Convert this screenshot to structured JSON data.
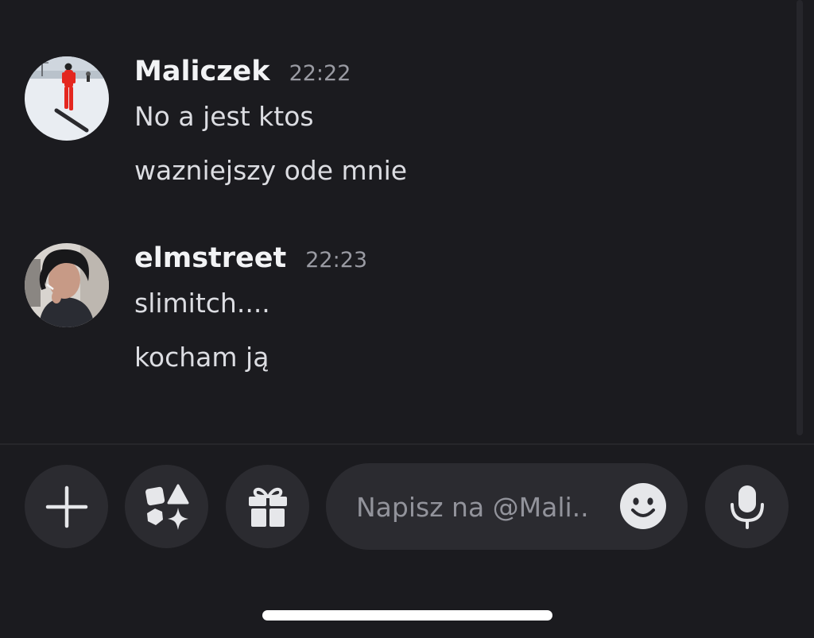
{
  "messages": [
    {
      "username": "Maliczek",
      "time": "22:22",
      "avatar": "snowboarder-photo",
      "lines": [
        "No a jest ktos",
        "wazniejszy ode mnie"
      ]
    },
    {
      "username": "elmstreet",
      "time": "22:23",
      "avatar": "portrait-photo",
      "lines": [
        "slimitch....",
        "kocham ją"
      ]
    }
  ],
  "composer": {
    "placeholder": "Napisz na @Mali..",
    "buttons": [
      "plus-icon",
      "apps-icon",
      "gift-icon",
      "microphone-icon"
    ],
    "emoji_icon": "smiley-icon"
  },
  "colors": {
    "background": "#1b1b1f",
    "button_bg": "#2b2b30",
    "username": "#f2f3f5",
    "timestamp": "#9a9ba3"
  }
}
